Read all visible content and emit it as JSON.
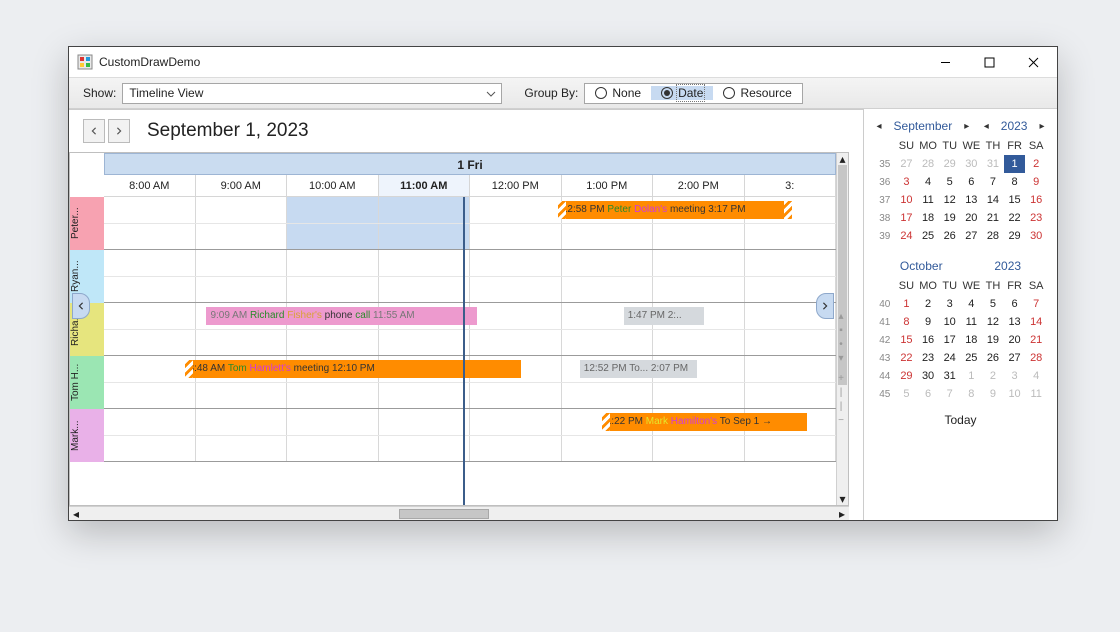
{
  "window": {
    "title": "CustomDrawDemo"
  },
  "toolbar": {
    "show_label": "Show:",
    "view": "Timeline View",
    "group_label": "Group By:",
    "radios": {
      "none": "None",
      "date": "Date",
      "resource": "Resource"
    }
  },
  "header": {
    "date": "September 1, 2023"
  },
  "day_header": "1 Fri",
  "hours": [
    "8:00 AM",
    "9:00 AM",
    "10:00 AM",
    "11:00 AM",
    "12:00 PM",
    "1:00 PM",
    "2:00 PM",
    "3:"
  ],
  "active_hour_index": 3,
  "resources": [
    {
      "name": "Peter...",
      "color": "#f7a2b1"
    },
    {
      "name": "Ryan...",
      "color": "#bfe7f8"
    },
    {
      "name": "Richa...",
      "color": "#e6e57e"
    },
    {
      "name": "Tom H...",
      "color": "#9be6b3"
    },
    {
      "name": "Mark...",
      "color": "#e9b1e8"
    }
  ],
  "events": [
    {
      "row": 0,
      "kind": "orange",
      "hatchL": true,
      "hatchR": true,
      "leftPct": 62,
      "widthPct": 32,
      "text": [
        "12:58 PM  ",
        "Peter ",
        "Dolan's ",
        "meeting",
        "        3:17 PM"
      ],
      "colors": [
        "#333",
        "#2a8a2a",
        "#d43bd4",
        "#333",
        "#333"
      ]
    },
    {
      "row": 2,
      "kind": "pink",
      "leftPct": 14,
      "widthPct": 37,
      "text": [
        "9:09 AM    ",
        "Richard ",
        "Fisher's ",
        "phone ",
        "call",
        "         11:55 AM"
      ],
      "colors": [
        "#777",
        "#2a8a2a",
        "#d9a237",
        "#333",
        "#2a8a2a",
        "#777"
      ]
    },
    {
      "row": 2,
      "kind": "gray",
      "leftPct": 71,
      "widthPct": 11,
      "text": [
        "1:47 PM 2:.."
      ],
      "colors": [
        "#666"
      ]
    },
    {
      "row": 3,
      "kind": "orange",
      "hatchL": true,
      "leftPct": 11,
      "widthPct": 46,
      "text": [
        "8:48 AM               ",
        "Tom ",
        "Hamlett's ",
        "meeting",
        "        12:10 PM"
      ],
      "colors": [
        "#333",
        "#2a8a2a",
        "#d43bd4",
        "#333",
        "#333"
      ]
    },
    {
      "row": 3,
      "kind": "gray",
      "leftPct": 65,
      "widthPct": 16,
      "text": [
        "12:52 PM To...  2:07 PM"
      ],
      "colors": [
        "#666"
      ]
    },
    {
      "row": 4,
      "kind": "orange",
      "hatchL": true,
      "leftPct": 68,
      "widthPct": 28,
      "text": [
        "1:22 PM ",
        "Mark ",
        "Hamilton's",
        "             To Sep 1 →"
      ],
      "colors": [
        "#333",
        "#e6e62a",
        "#d43bd4",
        "#333"
      ]
    }
  ],
  "now_position_pct": 49.5,
  "calendar1": {
    "month": "September",
    "year": "2023",
    "dow": [
      "",
      "SU",
      "MO",
      "TU",
      "WE",
      "TH",
      "FR",
      "SA"
    ],
    "rows": [
      {
        "wk": "35",
        "cells": [
          {
            "d": "27",
            "out": 1
          },
          {
            "d": "28",
            "out": 1
          },
          {
            "d": "29",
            "out": 1
          },
          {
            "d": "30",
            "out": 1
          },
          {
            "d": "31",
            "out": 1
          },
          {
            "d": "1",
            "today": 1
          },
          {
            "d": "2",
            "we": 1
          }
        ]
      },
      {
        "wk": "36",
        "cells": [
          {
            "d": "3",
            "we": 1
          },
          {
            "d": "4"
          },
          {
            "d": "5"
          },
          {
            "d": "6"
          },
          {
            "d": "7"
          },
          {
            "d": "8"
          },
          {
            "d": "9",
            "we": 1
          }
        ]
      },
      {
        "wk": "37",
        "cells": [
          {
            "d": "10",
            "we": 1
          },
          {
            "d": "11"
          },
          {
            "d": "12"
          },
          {
            "d": "13"
          },
          {
            "d": "14"
          },
          {
            "d": "15"
          },
          {
            "d": "16",
            "we": 1
          }
        ]
      },
      {
        "wk": "38",
        "cells": [
          {
            "d": "17",
            "we": 1
          },
          {
            "d": "18"
          },
          {
            "d": "19"
          },
          {
            "d": "20"
          },
          {
            "d": "21"
          },
          {
            "d": "22"
          },
          {
            "d": "23",
            "we": 1
          }
        ]
      },
      {
        "wk": "39",
        "cells": [
          {
            "d": "24",
            "we": 1
          },
          {
            "d": "25"
          },
          {
            "d": "26"
          },
          {
            "d": "27"
          },
          {
            "d": "28"
          },
          {
            "d": "29"
          },
          {
            "d": "30",
            "we": 1
          }
        ]
      }
    ]
  },
  "calendar2": {
    "month": "October",
    "year": "2023",
    "dow": [
      "",
      "SU",
      "MO",
      "TU",
      "WE",
      "TH",
      "FR",
      "SA"
    ],
    "rows": [
      {
        "wk": "40",
        "cells": [
          {
            "d": "1",
            "we": 1
          },
          {
            "d": "2"
          },
          {
            "d": "3"
          },
          {
            "d": "4"
          },
          {
            "d": "5"
          },
          {
            "d": "6"
          },
          {
            "d": "7",
            "we": 1
          }
        ]
      },
      {
        "wk": "41",
        "cells": [
          {
            "d": "8",
            "we": 1
          },
          {
            "d": "9"
          },
          {
            "d": "10"
          },
          {
            "d": "11"
          },
          {
            "d": "12"
          },
          {
            "d": "13"
          },
          {
            "d": "14",
            "we": 1
          }
        ]
      },
      {
        "wk": "42",
        "cells": [
          {
            "d": "15",
            "we": 1
          },
          {
            "d": "16"
          },
          {
            "d": "17"
          },
          {
            "d": "18"
          },
          {
            "d": "19"
          },
          {
            "d": "20"
          },
          {
            "d": "21",
            "we": 1
          }
        ]
      },
      {
        "wk": "43",
        "cells": [
          {
            "d": "22",
            "we": 1
          },
          {
            "d": "23"
          },
          {
            "d": "24"
          },
          {
            "d": "25"
          },
          {
            "d": "26"
          },
          {
            "d": "27"
          },
          {
            "d": "28",
            "we": 1
          }
        ]
      },
      {
        "wk": "44",
        "cells": [
          {
            "d": "29",
            "we": 1
          },
          {
            "d": "30"
          },
          {
            "d": "31"
          },
          {
            "d": "1",
            "out": 1
          },
          {
            "d": "2",
            "out": 1
          },
          {
            "d": "3",
            "out": 1
          },
          {
            "d": "4",
            "out": 1
          }
        ]
      },
      {
        "wk": "45",
        "cells": [
          {
            "d": "5",
            "out": 1
          },
          {
            "d": "6",
            "out": 1
          },
          {
            "d": "7",
            "out": 1
          },
          {
            "d": "8",
            "out": 1
          },
          {
            "d": "9",
            "out": 1
          },
          {
            "d": "10",
            "out": 1
          },
          {
            "d": "11",
            "out": 1
          }
        ]
      }
    ]
  },
  "today_label": "Today"
}
